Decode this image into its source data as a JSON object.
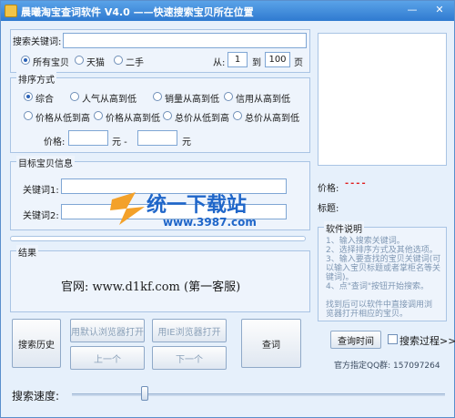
{
  "window": {
    "title": "晨曦淘宝查词软件 V4.0  ——快速搜索宝贝所在位置"
  },
  "search": {
    "keyword_label": "搜索关键词:",
    "keyword_value": "",
    "scope_options": [
      "所有宝贝",
      "天猫",
      "二手"
    ],
    "from_label": "从:",
    "from_value": "1",
    "to_label": "到",
    "to_value": "100",
    "page_unit": "页"
  },
  "sort": {
    "legend": "排序方式",
    "options_row1": [
      "综合",
      "人气从高到低",
      "销量从高到低",
      "信用从高到低"
    ],
    "options_row2": [
      "价格从低到高",
      "价格从高到低",
      "总价从低到高",
      "总价从高到低"
    ],
    "price_label": "价格:",
    "currency1": "元 -",
    "currency2": "元"
  },
  "target": {
    "legend": "目标宝贝信息",
    "keyword1_label": "关键词1:",
    "keyword2_label": "关键词2:"
  },
  "result": {
    "legend": "结果",
    "text": "官网: www.d1kf.com (第一客服)"
  },
  "right": {
    "price_label": "价格:",
    "price_value": "----",
    "title_label": "标题:",
    "manual_legend": "软件说明",
    "manual_lines": [
      "1、输入搜索关键词。",
      "2、选择排序方式及其他选项。",
      "3、输入要查找的宝贝关键词(可",
      "以输入宝贝标题或者掌柜名等关",
      "键词)。",
      "4、点\"查词\"按钮开始搜索。",
      "",
      "找到后可以软件中直接调用浏",
      "览器打开相应的宝贝。"
    ],
    "timing_button": "查询时间",
    "process_label": "搜索过程>>>",
    "qq_label": "官方指定QQ群: 157097264"
  },
  "buttons": {
    "history": "搜索历史",
    "open_default": "用默认浏览器打开",
    "open_ie": "用IE浏览器打开",
    "prev": "上一个",
    "next": "下一个",
    "search": "查词"
  },
  "speed": {
    "label": "搜索速度:"
  },
  "watermark": {
    "brand": "统一下载站",
    "url": "www.3987.com"
  }
}
